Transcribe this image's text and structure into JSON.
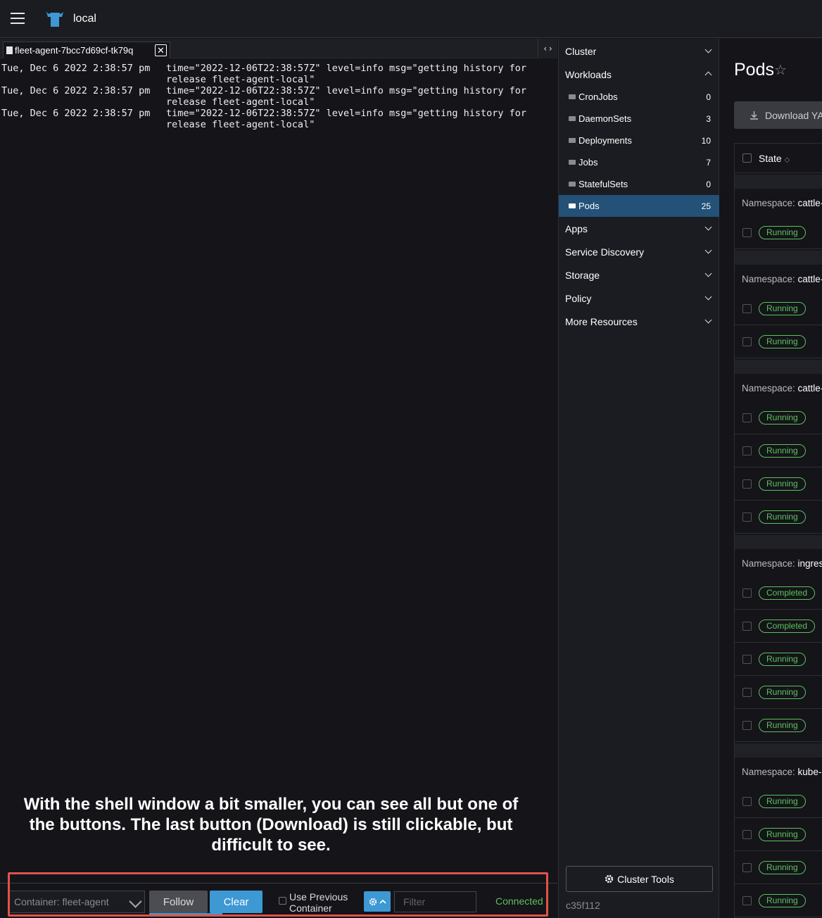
{
  "header": {
    "cluster_name": "local"
  },
  "log_tab": {
    "title": "fleet-agent-7bcc7d69cf-tk79q",
    "close_glyph": "✕",
    "expand_glyph": "‹›"
  },
  "log_lines": [
    {
      "timestamp": "Tue, Dec 6 2022 2:38:57 pm",
      "message": "time=\"2022-12-06T22:38:57Z\" level=info msg=\"getting history for\nrelease fleet-agent-local\""
    },
    {
      "timestamp": "Tue, Dec 6 2022 2:38:57 pm",
      "message": "time=\"2022-12-06T22:38:57Z\" level=info msg=\"getting history for\nrelease fleet-agent-local\""
    },
    {
      "timestamp": "Tue, Dec 6 2022 2:38:57 pm",
      "message": "time=\"2022-12-06T22:38:57Z\" level=info msg=\"getting history for\nrelease fleet-agent-local\""
    }
  ],
  "annotation": "With the shell window a bit smaller, you can see all but one of the buttons. The last button (Download) is still clickable, but difficult to see.",
  "log_footer": {
    "container_select": "Container: fleet-agent",
    "follow": "Follow",
    "clear": "Clear",
    "use_previous": "Use Previous Container",
    "filter_placeholder": "Filter",
    "status": "Connected"
  },
  "sidenav": {
    "groups": [
      "Cluster",
      "Workloads",
      "Apps",
      "Service Discovery",
      "Storage",
      "Policy",
      "More Resources"
    ],
    "workloads": [
      {
        "label": "CronJobs",
        "count": "0"
      },
      {
        "label": "DaemonSets",
        "count": "3"
      },
      {
        "label": "Deployments",
        "count": "10"
      },
      {
        "label": "Jobs",
        "count": "7"
      },
      {
        "label": "StatefulSets",
        "count": "0"
      },
      {
        "label": "Pods",
        "count": "25"
      }
    ],
    "cluster_tools": "Cluster Tools",
    "version": "c35f112"
  },
  "main": {
    "title": "Pods",
    "download_button": "Download YA",
    "state_header": "State",
    "namespace_prefix": "Namespace:",
    "namespaces": [
      "cattle-",
      "cattle-",
      "cattle-",
      "ingres",
      "kube-s"
    ],
    "states": [
      "Running",
      "Running",
      "Running",
      "Running",
      "Running",
      "Running",
      "Running",
      "Completed",
      "Completed",
      "Running",
      "Running",
      "Running",
      "Running",
      "Running",
      "Running",
      "Running"
    ]
  },
  "colors": {
    "accent": "#3d98d3",
    "status_ok": "#5dc15d",
    "highlight": "#e0534a",
    "active_nav": "#235178"
  }
}
